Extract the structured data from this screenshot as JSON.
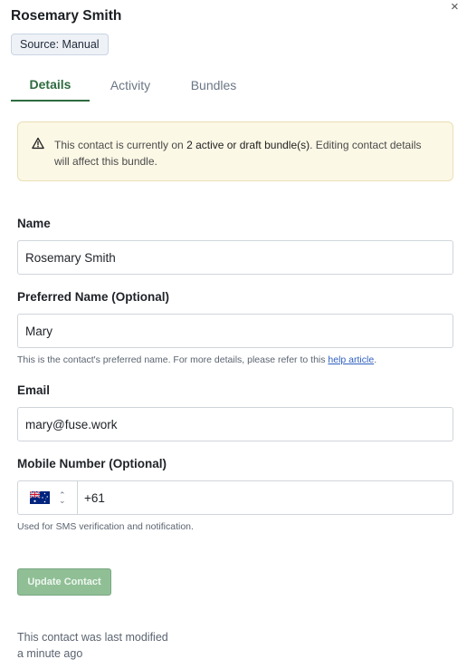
{
  "header": {
    "title": "Rosemary Smith",
    "source_badge": "Source: Manual",
    "close_glyph": "×"
  },
  "tabs": [
    {
      "label": "Details",
      "active": true
    },
    {
      "label": "Activity",
      "active": false
    },
    {
      "label": "Bundles",
      "active": false
    }
  ],
  "warning": {
    "icon": "warning-triangle-icon",
    "prefix": "This contact is currently on ",
    "highlight": "2 active or draft bundle(s)",
    "suffix": ". Editing contact details will affect this bundle."
  },
  "form": {
    "name": {
      "label": "Name",
      "value": "Rosemary Smith"
    },
    "preferred_name": {
      "label": "Preferred Name (Optional)",
      "value": "Mary",
      "hint_prefix": "This is the contact's preferred name. For more details, please refer to this ",
      "hint_link": "help article",
      "hint_suffix": "."
    },
    "email": {
      "label": "Email",
      "value": "mary@fuse.work"
    },
    "mobile": {
      "label": "Mobile Number (Optional)",
      "country_flag": "australia-flag-icon",
      "value": "+61",
      "hint": "Used for SMS verification and notification."
    }
  },
  "actions": {
    "update_label": "Update Contact"
  },
  "footer": {
    "line1": "This contact was last modified",
    "line2": "a minute ago"
  },
  "colors": {
    "accent": "#2e6b3f",
    "button": "#90bf96",
    "warning_bg": "#fcf8e6",
    "link": "#2f5fbf"
  }
}
